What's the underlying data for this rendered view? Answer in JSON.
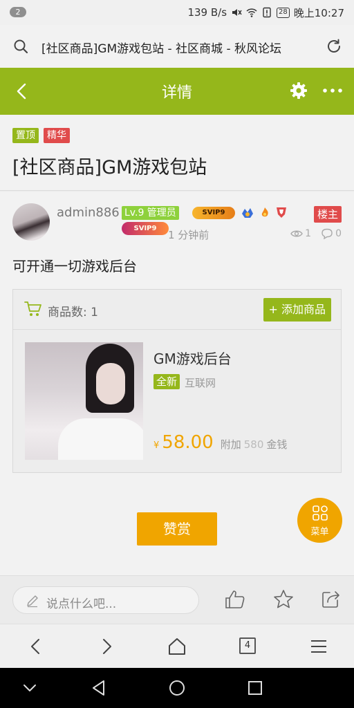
{
  "status_bar": {
    "notification_count": "2",
    "net_speed": "139 B/s",
    "battery": "28",
    "time": "晚上10:27"
  },
  "browser": {
    "url_title": "[社区商品]GM游戏包站 - 社区商城 - 秋风论坛",
    "tabs_count": "4"
  },
  "header": {
    "title": "详情",
    "accent_color": "#95b71b"
  },
  "thread": {
    "tags": [
      "置顶",
      "精华"
    ],
    "title": "[社区商品]GM游戏包站"
  },
  "post": {
    "username": "admin886",
    "level_badge": "Lv.9 管理员",
    "svip_badge_1": "SVIP9",
    "svip_badge_2": "SVIP9",
    "op_badge": "楼主",
    "time": "1 分钟前",
    "views": "1",
    "comments": "0",
    "content": "可开通一切游戏后台"
  },
  "goods": {
    "count_label": "商品数: 1",
    "add_button": "+ 添加商品",
    "item": {
      "name": "GM游戏后台",
      "condition_tag": "全新",
      "source": "互联网",
      "price_symbol": "¥",
      "price": "58.00",
      "extra_label": "附加",
      "extra_value": "580",
      "extra_unit": "金钱"
    }
  },
  "actions": {
    "reward_button": "赞赏",
    "menu_fab": "菜单",
    "highlight_color": "#f0a500"
  },
  "comment_bar": {
    "placeholder": "说点什么吧..."
  }
}
